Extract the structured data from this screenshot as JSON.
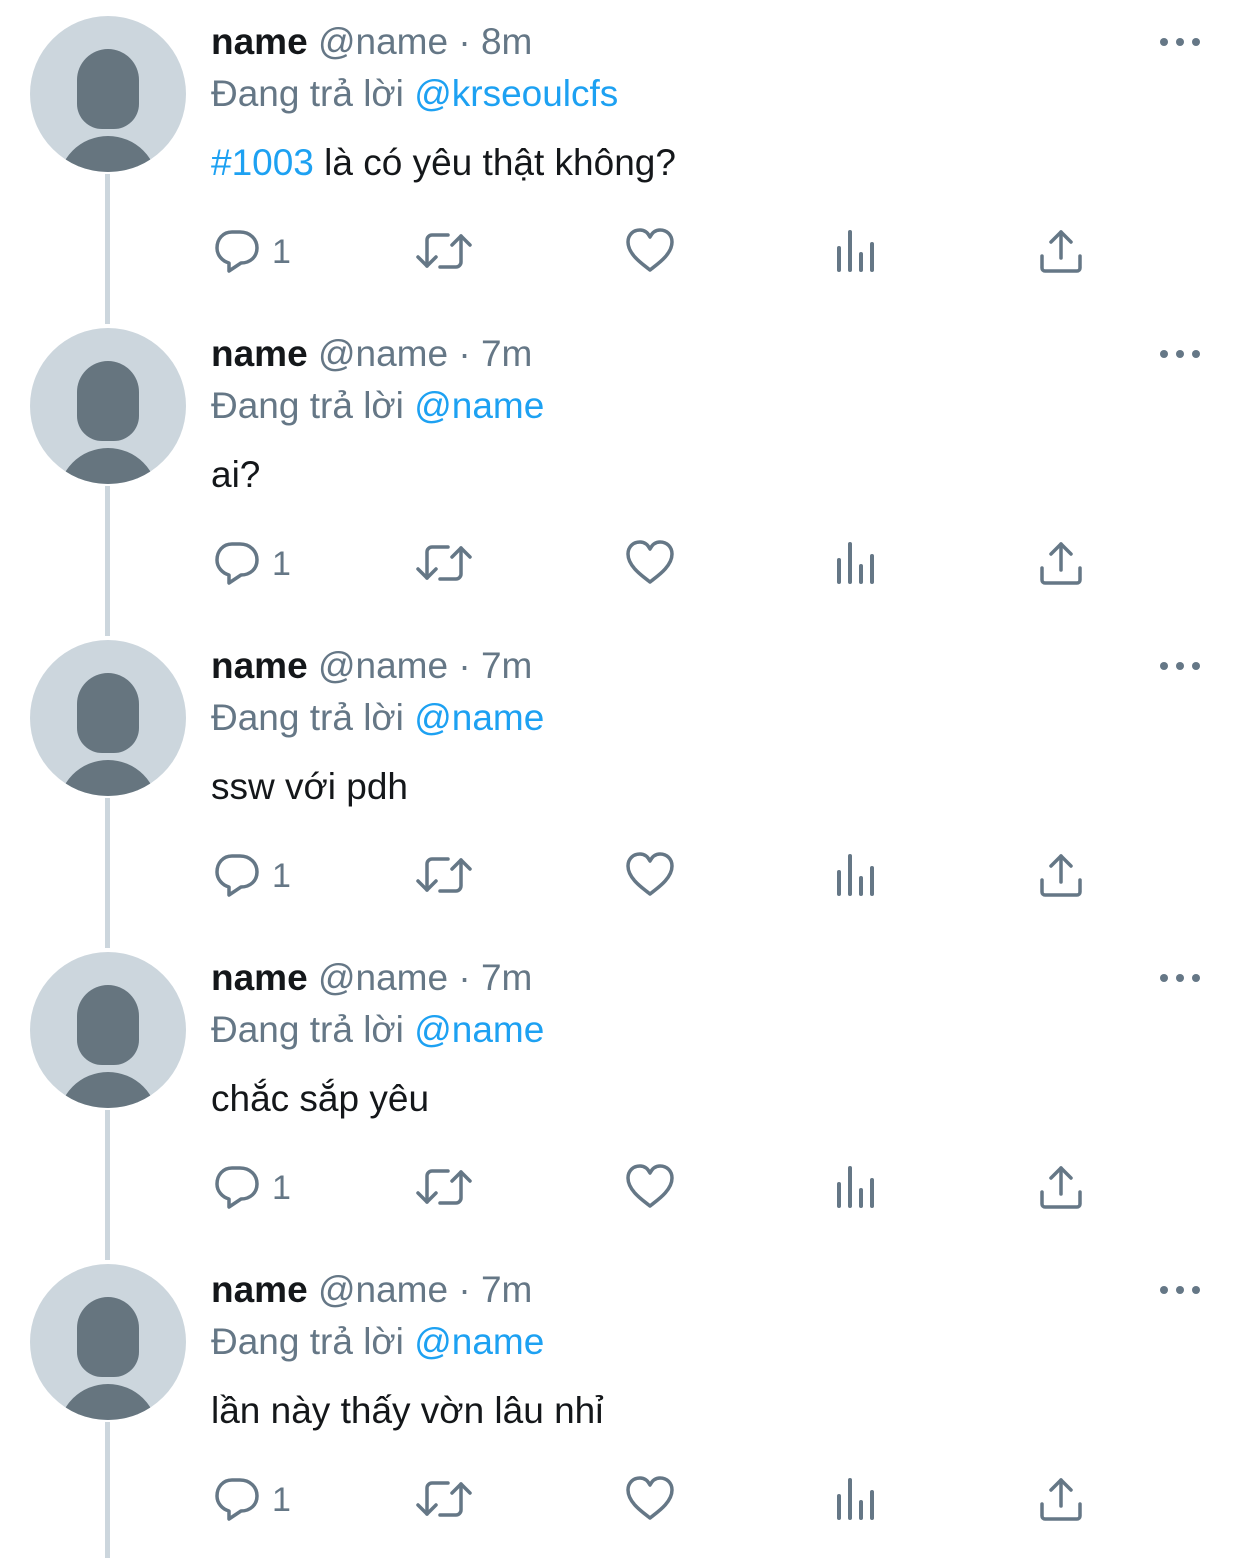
{
  "tweets": [
    {
      "display_name": "name",
      "handle": "@name",
      "separator": "·",
      "time": "8m",
      "replying_prefix": "Đang trả lời",
      "replying_to": "@krseoulcfs",
      "hashtag": "#1003",
      "text": " là có yêu thật không?",
      "reply_count": "1",
      "show_thread_line": true
    },
    {
      "display_name": "name",
      "handle": "@name",
      "separator": "·",
      "time": "7m",
      "replying_prefix": "Đang trả lời",
      "replying_to": "@name",
      "hashtag": "",
      "text": "ai?",
      "reply_count": "1",
      "show_thread_line": true
    },
    {
      "display_name": "name",
      "handle": "@name",
      "separator": "·",
      "time": "7m",
      "replying_prefix": "Đang trả lời",
      "replying_to": "@name",
      "hashtag": "",
      "text": "ssw với pdh",
      "reply_count": "1",
      "show_thread_line": true
    },
    {
      "display_name": "name",
      "handle": "@name",
      "separator": "·",
      "time": "7m",
      "replying_prefix": "Đang trả lời",
      "replying_to": "@name",
      "hashtag": "",
      "text": "chắc sắp yêu",
      "reply_count": "1",
      "show_thread_line": true
    },
    {
      "display_name": "name",
      "handle": "@name",
      "separator": "·",
      "time": "7m",
      "replying_prefix": "Đang trả lời",
      "replying_to": "@name",
      "hashtag": "",
      "text": "lần này thấy vờn lâu nhỉ",
      "reply_count": "1",
      "show_thread_line": true
    }
  ],
  "icons": {
    "reply": "reply-icon",
    "retweet": "retweet-icon",
    "like": "heart-icon",
    "analytics": "analytics-icon",
    "share": "share-icon",
    "more": "more-icon"
  },
  "colors": {
    "text_primary": "#14171a",
    "text_secondary": "#657786",
    "link": "#1da1f2",
    "avatar_bg": "#ccd6dd",
    "avatar_fg": "#66757f",
    "thread_line": "#ccd6dd"
  }
}
